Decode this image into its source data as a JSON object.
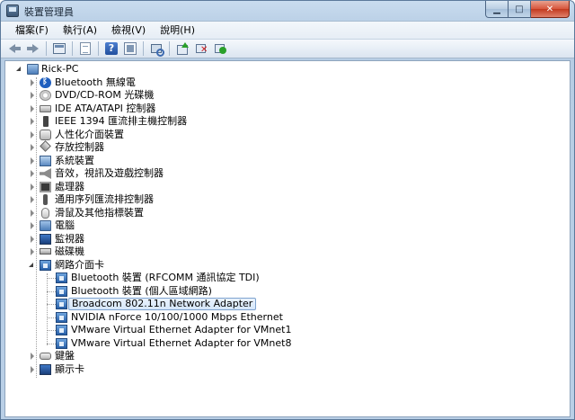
{
  "window": {
    "title": "裝置管理員"
  },
  "menu": [
    "檔案(F)",
    "執行(A)",
    "檢視(V)",
    "說明(H)"
  ],
  "toolbar": {
    "buttons": [
      "back-icon",
      "forward-icon",
      "console-tree-icon",
      "properties-page-icon",
      "help-icon",
      "properties-icon",
      "scan-hardware-icon",
      "update-driver-icon",
      "uninstall-icon",
      "enable-icon"
    ]
  },
  "tree": {
    "root": "Rick-PC",
    "categories": [
      "Bluetooth 無線電",
      "DVD/CD-ROM 光碟機",
      "IDE ATA/ATAPI 控制器",
      "IEEE 1394 匯流排主機控制器",
      "人性化介面裝置",
      "存放控制器",
      "系統裝置",
      "音效，視訊及遊戲控制器",
      "處理器",
      "通用序列匯流排控制器",
      "滑鼠及其他指標裝置",
      "電腦",
      "監視器",
      "磁碟機",
      "網路介面卡",
      "鍵盤",
      "顯示卡"
    ],
    "network_children": [
      "Bluetooth 裝置 (RFCOMM 通訊協定 TDI)",
      "Bluetooth 裝置 (個人區域網路)",
      "Broadcom 802.11n Network Adapter",
      "NVIDIA nForce 10/100/1000 Mbps Ethernet",
      "VMware Virtual Ethernet Adapter for VMnet1",
      "VMware Virtual Ethernet Adapter for VMnet8"
    ],
    "selected": "Broadcom 802.11n Network Adapter"
  }
}
